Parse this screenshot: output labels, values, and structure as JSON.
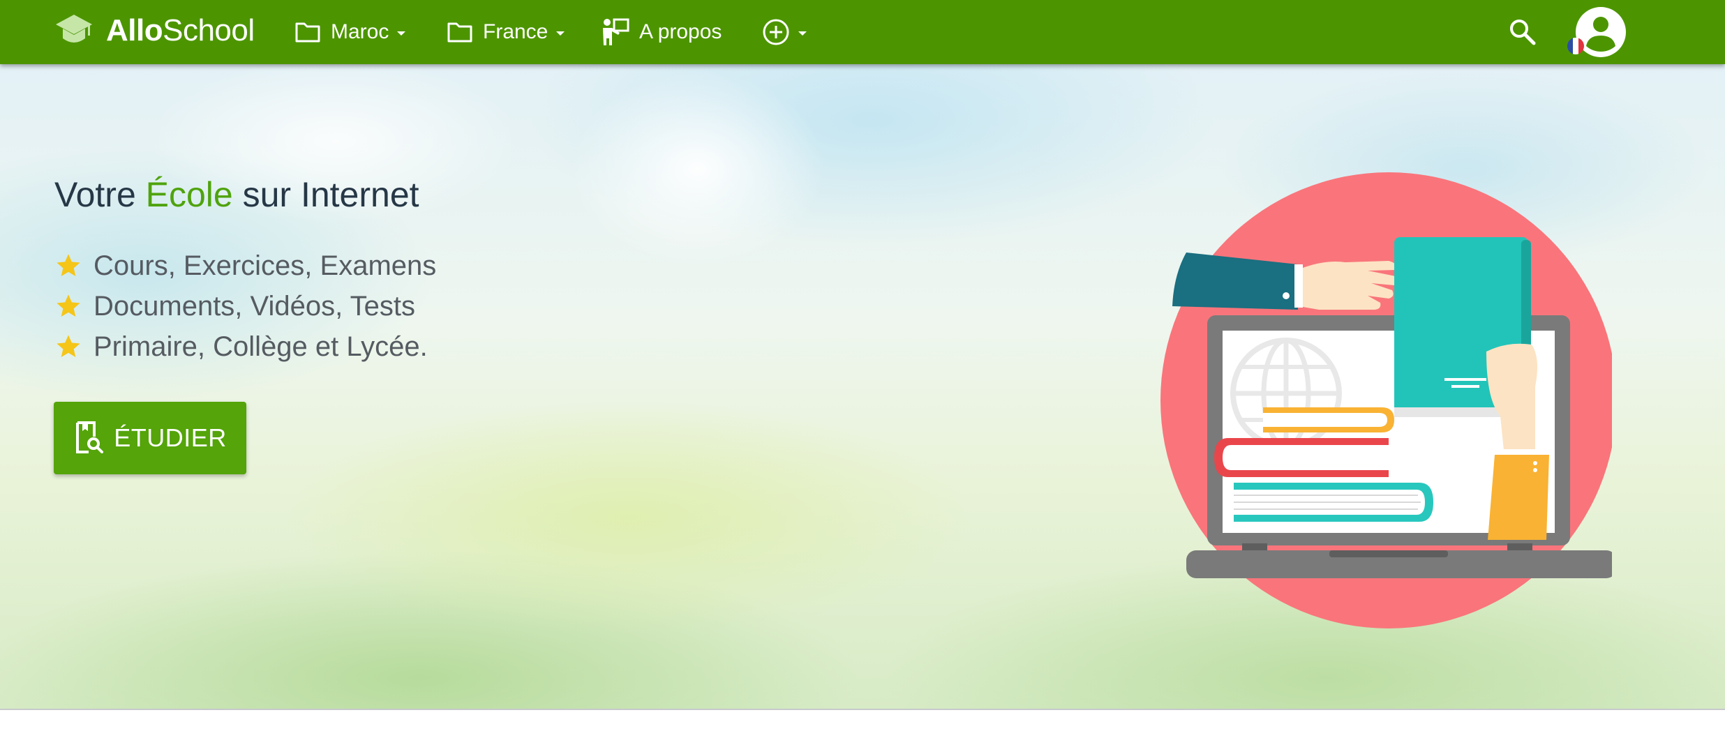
{
  "brand": {
    "name_bold": "Allo",
    "name_regular": "School"
  },
  "nav": {
    "menus": [
      {
        "label": "Maroc",
        "icon": "folder-icon"
      },
      {
        "label": "France",
        "icon": "folder-icon"
      },
      {
        "label": "A propos",
        "icon": "teacher-icon"
      }
    ],
    "add_icon": "plus-circle-icon",
    "search_icon": "search-icon",
    "user_icon": "account-circle-icon",
    "language_flag": "france-flag-icon"
  },
  "hero": {
    "title_part1": "Votre ",
    "title_highlight": "École",
    "title_part2": " sur Internet",
    "features": [
      "Cours, Exercices, Examens",
      "Documents, Vidéos, Tests",
      "Primaire, Collège et Lycée."
    ],
    "cta_label": "ÉTUDIER",
    "cta_icon": "book-search-icon"
  },
  "colors": {
    "navbar": "#4c9500",
    "accent": "#4fa30d",
    "button": "#54a40a",
    "star": "#f5c518",
    "illustration_circle": "#f9757b"
  }
}
